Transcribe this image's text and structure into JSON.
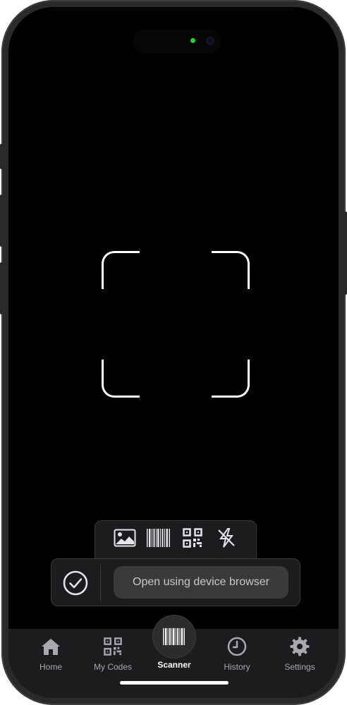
{
  "colors": {
    "background": "#000000",
    "accent": "#ffffff",
    "panel": "#1c1c1e",
    "inactive_tab": "#a8a8ad",
    "camera_led": "#2ecc40"
  },
  "scanner": {
    "frame_icon": "viewfinder-corners",
    "tools": [
      {
        "icon": "photo-icon"
      },
      {
        "icon": "barcode-icon"
      },
      {
        "icon": "qr-code-icon"
      },
      {
        "icon": "flash-off-icon"
      }
    ]
  },
  "action_bar": {
    "confirm_icon": "checkmark-circle-icon",
    "open_button_label": "Open using device browser"
  },
  "tabs": [
    {
      "label": "Home",
      "icon": "house-icon",
      "active": false
    },
    {
      "label": "My Codes",
      "icon": "qr-code-icon",
      "active": false
    },
    {
      "label": "Scanner",
      "icon": "barcode-icon",
      "active": true
    },
    {
      "label": "History",
      "icon": "clock-icon",
      "active": false
    },
    {
      "label": "Settings",
      "icon": "gear-icon",
      "active": false
    }
  ]
}
